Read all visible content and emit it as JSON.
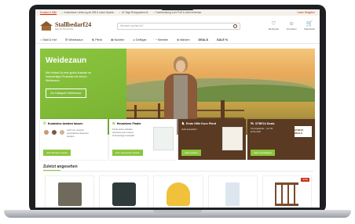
{
  "top_bar": {
    "link": "Kontakt & Hilfe",
    "usps": [
      "Kostenlose Lieferung ab 99€ & sofort Sparen",
      "30 Tage Rückgaberecht",
      "Fachberatung vom Profi & sofort lieferbar"
    ],
    "right": "Unser Ratgeber"
  },
  "header": {
    "logo_text": "Stallbedarf24",
    "logo_sub": "Alles für Hof und Tier",
    "search_placeholder": "Wonach suchst du?",
    "icons": [
      {
        "name": "Merkzettel",
        "glyph": "♡"
      },
      {
        "name": "Anmelden",
        "glyph": "☺"
      },
      {
        "name": "Warenkorb",
        "glyph": "🛒"
      }
    ]
  },
  "nav": {
    "items": [
      "Stall & Hof",
      "Weidezaun",
      "Pferd",
      "Nutztier",
      "Geflügel",
      "Kleintier",
      "Marken",
      "DEALS",
      "SALE %"
    ]
  },
  "hero": {
    "title": "Weidezaun",
    "text": "Hier findest Du eine große Auswahl an hochwertigen Produkten für deinen Weidezaun!",
    "button": "Zur Kategorie Weidezaun"
  },
  "cards": [
    {
      "title": "Kostenlos beraten lassen",
      "text": "Jetzt von unseren persönlichen Experten beraten.",
      "button": "Jetzt Beraten lassen"
    },
    {
      "title": "Heunetzen Finder",
      "text": "Finde deine perfekte Heuraufe aus unserer hochwertigen Auswahl.",
      "button": "Zum Heunetzen Finder"
    },
    {
      "title": "Erste Hilfe Kurs Pferd",
      "text": "Jetzt anmelden!",
      "button": "Jetzt buchen"
    },
    {
      "title": "STBF24 Deals",
      "text": "Top Angebote – nur für kurze Zeit!",
      "button": "Jetzt zuschlagen!",
      "badge": "STBF24 DEALS"
    }
  ],
  "recently_viewed": {
    "title": "Zuletzt angesehen",
    "sale_label": "SALE"
  }
}
